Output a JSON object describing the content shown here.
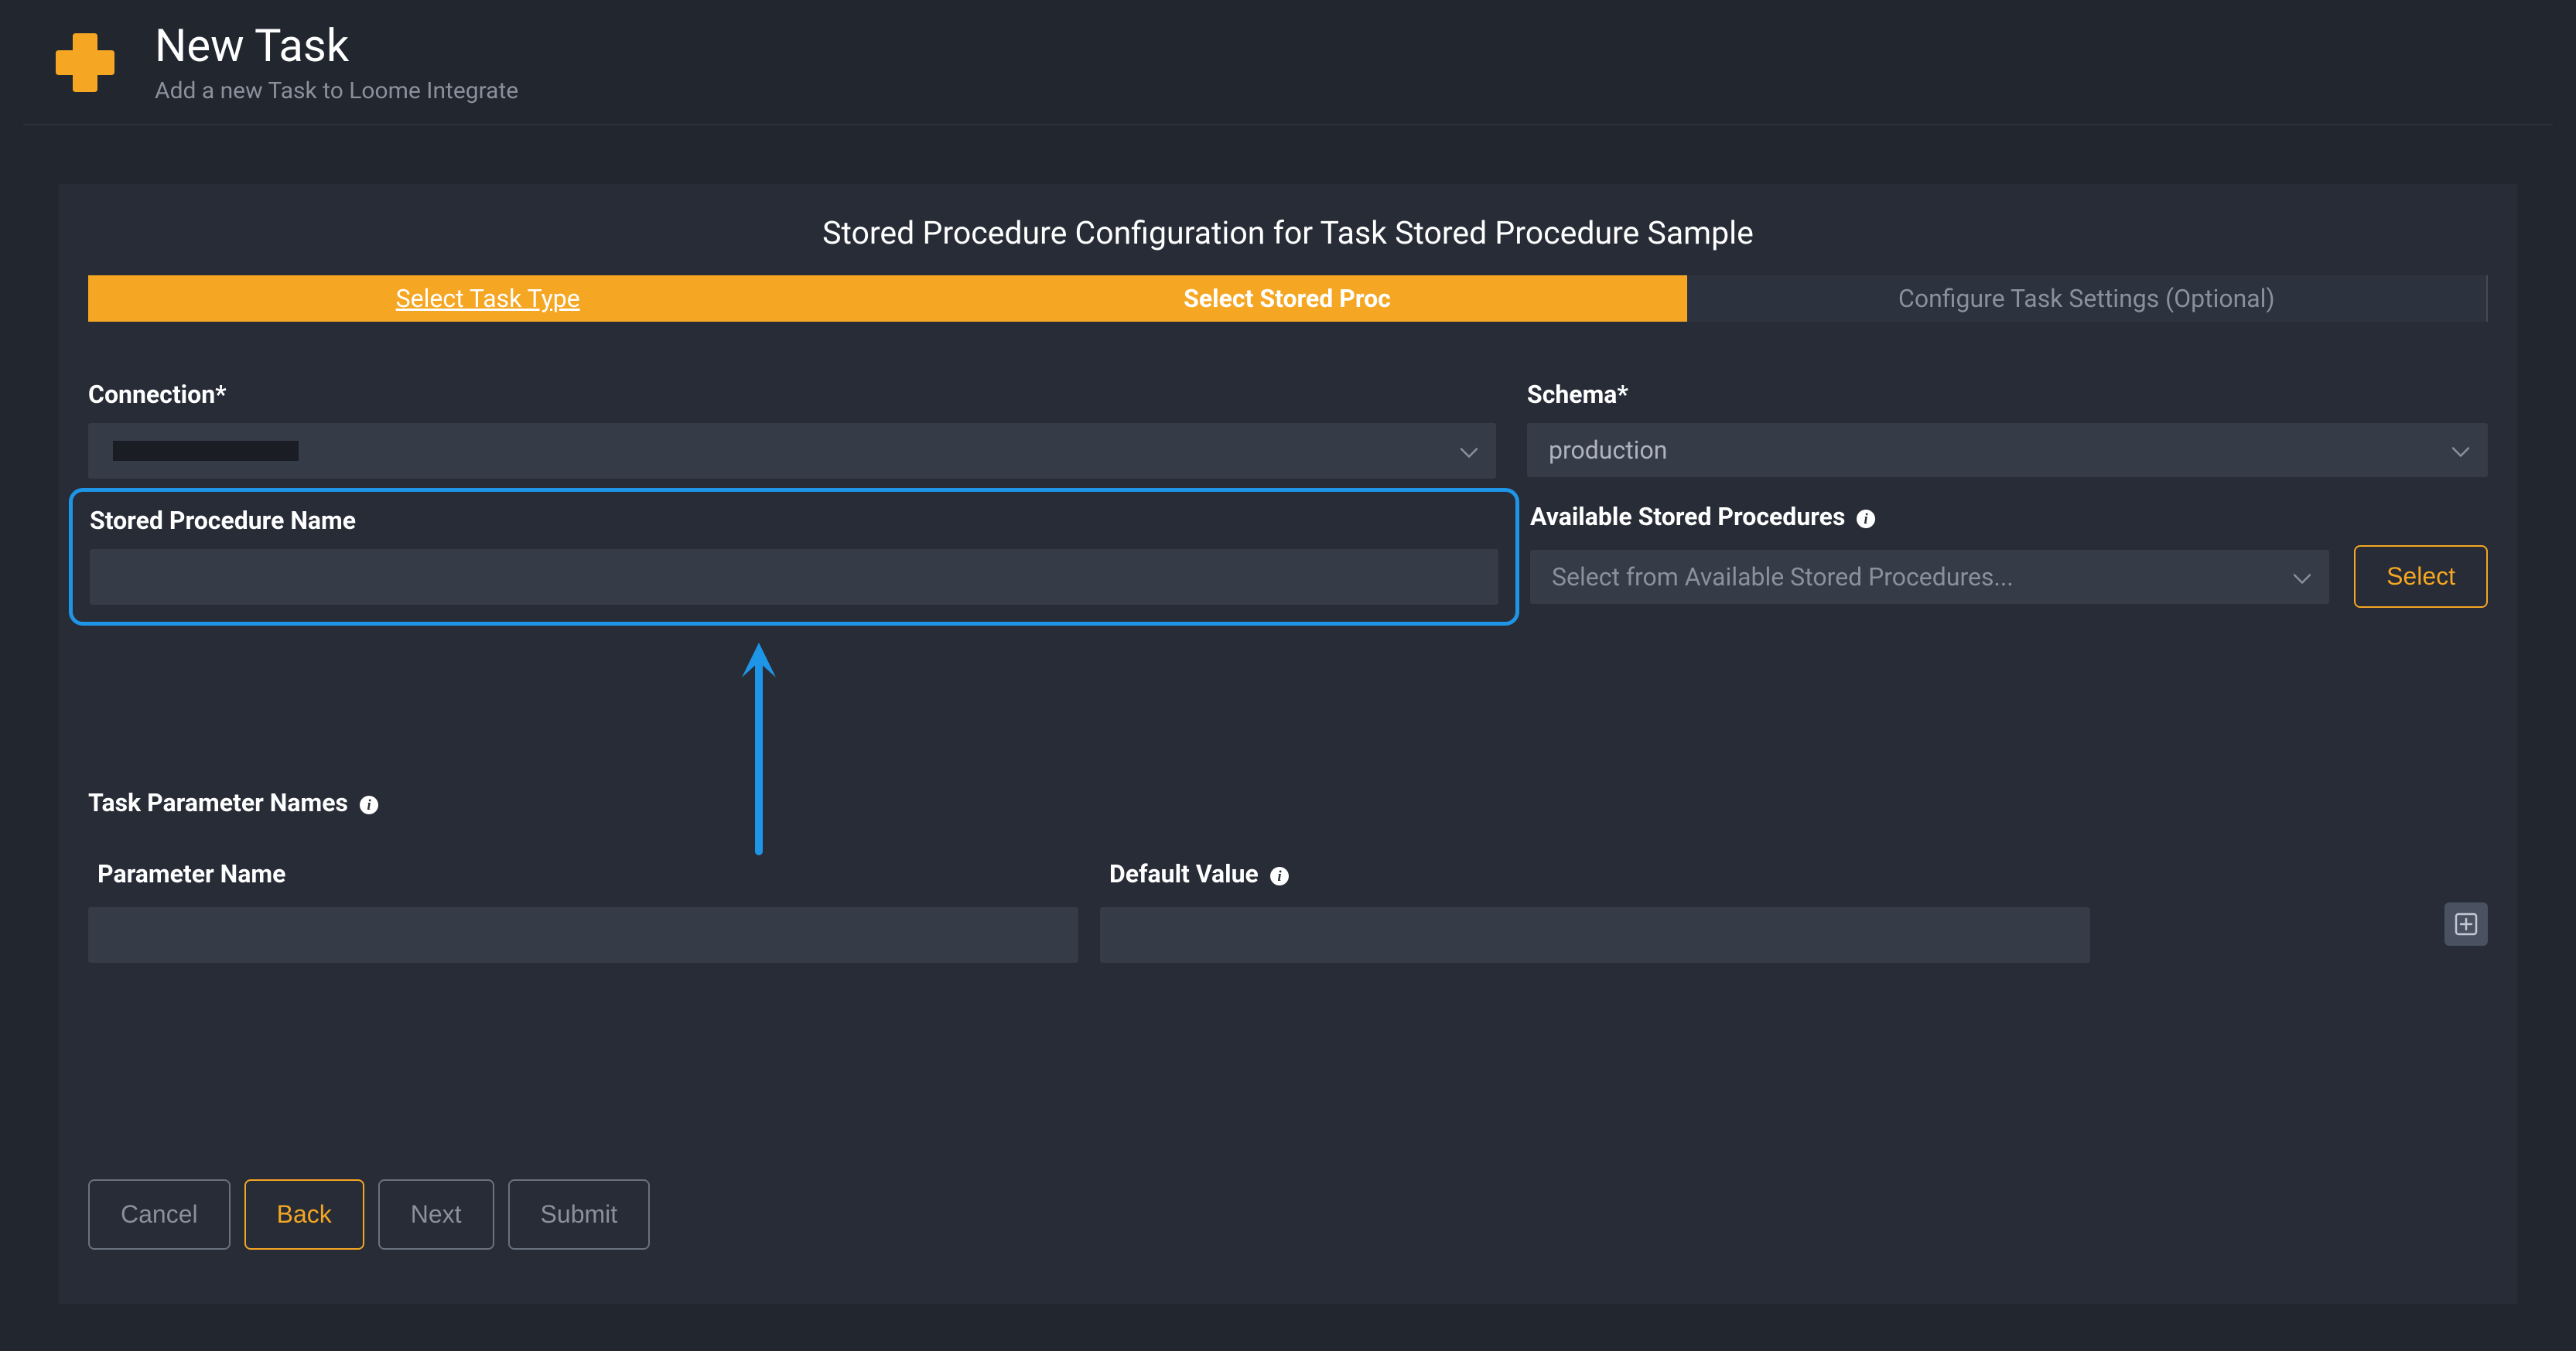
{
  "header": {
    "title": "New Task",
    "subtitle": "Add a new Task to Loome Integrate"
  },
  "panel": {
    "title": "Stored Procedure Configuration for Task Stored Procedure Sample"
  },
  "tabs": {
    "select_task_type": "Select Task Type",
    "select_stored_proc": "Select Stored Proc",
    "configure_settings": "Configure Task Settings (Optional)"
  },
  "form": {
    "connection_label": "Connection*",
    "connection_value": "",
    "schema_label": "Schema*",
    "schema_value": "production",
    "stored_proc_name_label": "Stored Procedure Name",
    "stored_proc_name_value": "",
    "available_procs_label": "Available Stored Procedures",
    "available_procs_placeholder": "Select from Available Stored Procedures...",
    "select_button": "Select"
  },
  "params": {
    "section_label": "Task Parameter Names",
    "param_name_label": "Parameter Name",
    "default_value_label": "Default Value",
    "param_name_value": "",
    "default_value_value": ""
  },
  "buttons": {
    "cancel": "Cancel",
    "back": "Back",
    "next": "Next",
    "submit": "Submit"
  },
  "colors": {
    "accent": "#f5a623",
    "highlight": "#1e95e6"
  }
}
